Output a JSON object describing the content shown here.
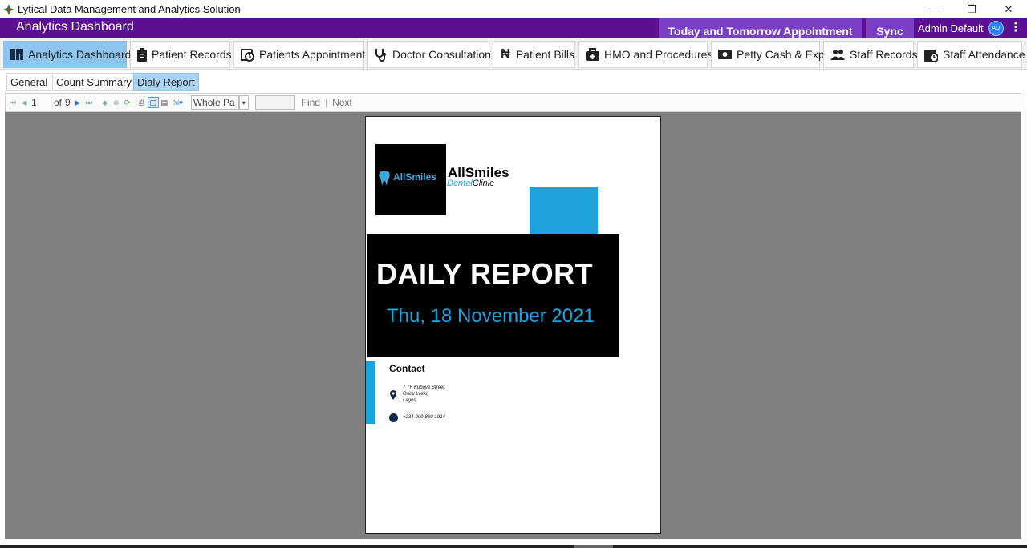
{
  "window": {
    "title": "Lytical Data Management and Analytics Solution",
    "minimize": "—",
    "restore": "❐",
    "close": "✕"
  },
  "header": {
    "title": "Analytics Dashboard",
    "appointment_button": "Today and Tomorrow Appointment",
    "sync_button": "Sync",
    "user_name": "Admin Default",
    "user_initials": "AD"
  },
  "nav": {
    "tabs": [
      {
        "label": "Analytics Dashboard",
        "icon": "dashboard-icon"
      },
      {
        "label": "Patient Records",
        "icon": "clipboard-icon"
      },
      {
        "label": "Patients Appointment",
        "icon": "calendar-clock-icon"
      },
      {
        "label": "Doctor Consultation",
        "icon": "stethoscope-icon"
      },
      {
        "label": "Patient Bills",
        "icon": "naira-icon"
      },
      {
        "label": "HMO and Procedures",
        "icon": "medical-bag-icon"
      },
      {
        "label": "Petty Cash & Exp.",
        "icon": "cash-icon"
      },
      {
        "label": "Staff Records",
        "icon": "people-icon"
      },
      {
        "label": "Staff Attendance",
        "icon": "attendance-icon"
      }
    ]
  },
  "subtabs": [
    {
      "label": "General"
    },
    {
      "label": "Count Summary"
    },
    {
      "label": "Dialy Report"
    }
  ],
  "toolbar": {
    "current_page": "1",
    "of_label": "of",
    "total_pages": "9",
    "zoom": "Whole Pa",
    "find_label": "Find",
    "next_label": "Next"
  },
  "report": {
    "brand_name": "AllSmiles",
    "brand_sub_dental": "Dental",
    "brand_sub_clinic": "Clinic",
    "logo_text": "AllSmiles",
    "title": "DAILY REPORT",
    "date": "Thu, 18 November 2021",
    "contact_heading": "Contact",
    "address_line1": "7 TF Kuboye Street,",
    "address_line2": "Oniru Lekki,",
    "address_line3": "Lagos",
    "phone": "+234-909-860-1914"
  },
  "colors": {
    "header_purple": "#5c0f91",
    "header_button": "#7a3fc4",
    "active_tab": "#8ec5ee",
    "accent_blue": "#1ea2dd"
  }
}
